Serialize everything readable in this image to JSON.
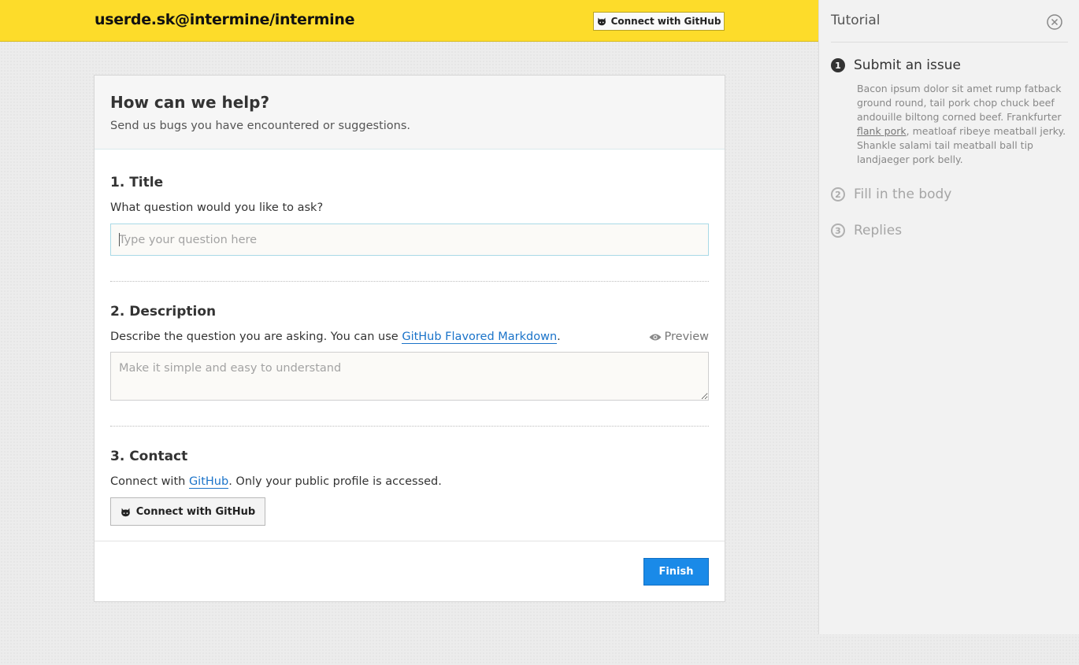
{
  "header": {
    "repo": "userde.sk@intermine/intermine",
    "connect_label": "Connect with GitHub"
  },
  "card": {
    "heading": "How can we help?",
    "subheading": "Send us bugs you have encountered or suggestions."
  },
  "title_section": {
    "heading": "1. Title",
    "question": "What question would you like to ask?",
    "input_value": "",
    "input_placeholder": "Type your question here"
  },
  "description_section": {
    "heading": "2. Description",
    "text_before": "Describe the question you are asking. You can use ",
    "link": "GitHub Flavored Markdown",
    "text_after": ".",
    "preview_label": "Preview",
    "textarea_value": "",
    "textarea_placeholder": "Make it simple and easy to understand"
  },
  "contact_section": {
    "heading": "3. Contact",
    "text_before": "Connect with ",
    "link": "GitHub",
    "text_after": ". Only your public profile is accessed.",
    "button_label": "Connect with GitHub"
  },
  "footer": {
    "finish_label": "Finish"
  },
  "tutorial": {
    "title": "Tutorial",
    "steps": [
      {
        "number": "1",
        "label": "Submit an issue",
        "body_before": "Bacon ipsum dolor sit amet rump fatback ground round, tail pork chop chuck beef andouille biltong corned beef. Frankfurter ",
        "body_link": "flank pork",
        "body_after": ", meatloaf ribeye meatball jerky. Shankle salami tail meatball ball tip landjaeger pork belly."
      },
      {
        "number": "2",
        "label": "Fill in the body"
      },
      {
        "number": "3",
        "label": "Replies"
      }
    ]
  },
  "colors": {
    "header_bg": "#fddc2a",
    "primary_button": "#1a8ae8",
    "link": "#1a73c9"
  },
  "icons": {
    "github": "octocat-icon",
    "preview": "eye-icon",
    "close": "close-circle-icon"
  }
}
